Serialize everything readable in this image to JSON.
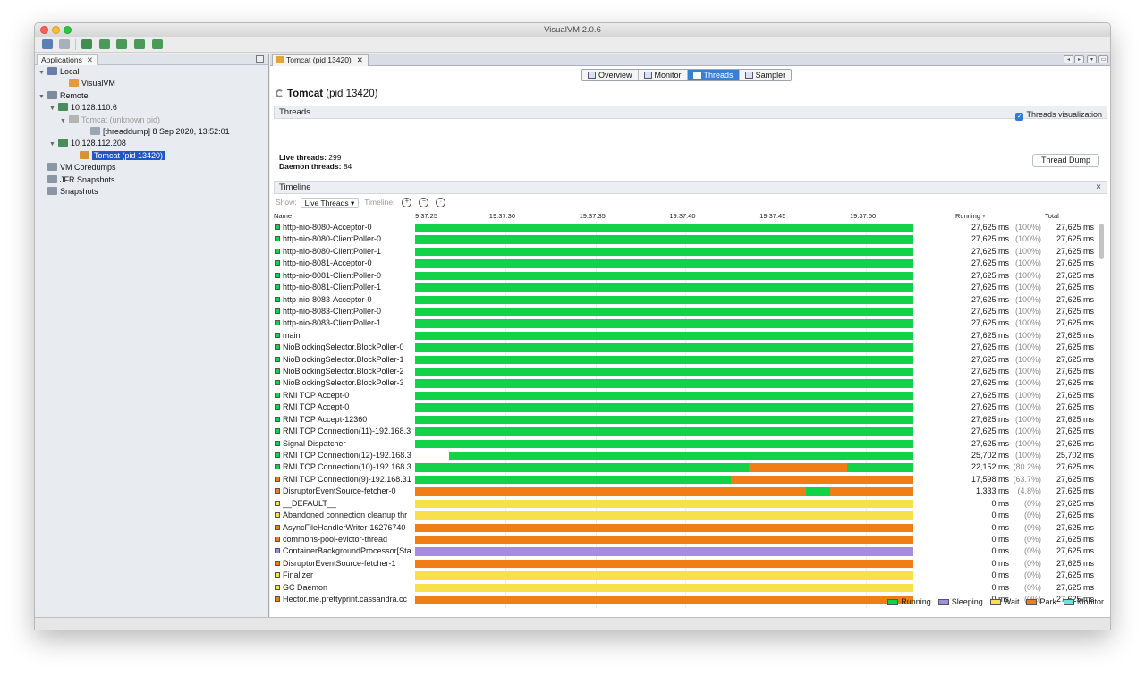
{
  "window": {
    "title": "VisualVM 2.0.6"
  },
  "left": {
    "tab_label": "Applications",
    "tree": [
      {
        "label": "Local",
        "indent": 0,
        "arrow": "▼",
        "icon": "computer-icon",
        "color": "#6b7fa6",
        "dim": false,
        "selected": false
      },
      {
        "label": "VisualVM",
        "indent": 2,
        "arrow": "",
        "icon": "java-icon",
        "color": "#e69a3c",
        "dim": false,
        "selected": false
      },
      {
        "label": "Remote",
        "indent": 0,
        "arrow": "▼",
        "icon": "network-icon",
        "color": "#7d8a9b",
        "dim": false,
        "selected": false
      },
      {
        "label": "10.128.110.6",
        "indent": 1,
        "arrow": "▼",
        "icon": "host-icon",
        "color": "#4a8d5a",
        "dim": false,
        "selected": false
      },
      {
        "label": "Tomcat (unknown pid)",
        "indent": 2,
        "arrow": "▼",
        "icon": "tomcat-icon",
        "color": "#b5b5b5",
        "dim": true,
        "selected": false
      },
      {
        "label": "[threaddump] 8 Sep 2020, 13:52:01",
        "indent": 4,
        "arrow": "",
        "icon": "threaddump-icon",
        "color": "#9ba5b3",
        "dim": false,
        "selected": false
      },
      {
        "label": "10.128.112.208",
        "indent": 1,
        "arrow": "▼",
        "icon": "host-icon",
        "color": "#4a8d5a",
        "dim": false,
        "selected": false
      },
      {
        "label": "Tomcat (pid 13420)",
        "indent": 3,
        "arrow": "",
        "icon": "tomcat-icon",
        "color": "#d89432",
        "dim": false,
        "selected": true
      },
      {
        "label": "VM Coredumps",
        "indent": 0,
        "arrow": "",
        "icon": "coredump-icon",
        "color": "#8c97a6",
        "dim": false,
        "selected": false
      },
      {
        "label": "JFR Snapshots",
        "indent": 0,
        "arrow": "",
        "icon": "jfr-icon",
        "color": "#8c97a6",
        "dim": false,
        "selected": false
      },
      {
        "label": "Snapshots",
        "indent": 0,
        "arrow": "",
        "icon": "snapshot-icon",
        "color": "#8c97a6",
        "dim": false,
        "selected": false
      }
    ]
  },
  "doc": {
    "tab_label": "Tomcat (pid 13420)",
    "views": [
      {
        "label": "Overview",
        "active": false
      },
      {
        "label": "Monitor",
        "active": false
      },
      {
        "label": "Threads",
        "active": true
      },
      {
        "label": "Sampler",
        "active": false
      }
    ],
    "app_name": "Tomcat",
    "app_pid": "(pid 13420)",
    "threads_header": "Threads",
    "viz_label": "Threads visualization",
    "live_label": "Live threads:",
    "live_value": "299",
    "daemon_label": "Daemon threads:",
    "daemon_value": "84",
    "dump_button": "Thread Dump",
    "timeline_header": "Timeline",
    "show_label": "Show:",
    "show_value": "Live Threads",
    "timeline_label": "Timeline:"
  },
  "table": {
    "col_name": "Name",
    "col_running": "Running",
    "col_total": "Total",
    "time_ticks": [
      "9:37:25",
      "19:37:30",
      "19:37:35",
      "19:37:40",
      "19:37:45",
      "19:37:50"
    ],
    "rows": [
      {
        "name": "http-nio-8080-Acceptor-0",
        "state": "running",
        "running": "27,625 ms",
        "pct": "(100%)",
        "total": "27,625 ms",
        "segments": [
          [
            "running",
            0,
            1
          ]
        ]
      },
      {
        "name": "http-nio-8080-ClientPoller-0",
        "state": "running",
        "running": "27,625 ms",
        "pct": "(100%)",
        "total": "27,625 ms",
        "segments": [
          [
            "running",
            0,
            1
          ]
        ]
      },
      {
        "name": "http-nio-8080-ClientPoller-1",
        "state": "running",
        "running": "27,625 ms",
        "pct": "(100%)",
        "total": "27,625 ms",
        "segments": [
          [
            "running",
            0,
            1
          ]
        ]
      },
      {
        "name": "http-nio-8081-Acceptor-0",
        "state": "running",
        "running": "27,625 ms",
        "pct": "(100%)",
        "total": "27,625 ms",
        "segments": [
          [
            "running",
            0,
            1
          ]
        ]
      },
      {
        "name": "http-nio-8081-ClientPoller-0",
        "state": "running",
        "running": "27,625 ms",
        "pct": "(100%)",
        "total": "27,625 ms",
        "segments": [
          [
            "running",
            0,
            1
          ]
        ]
      },
      {
        "name": "http-nio-8081-ClientPoller-1",
        "state": "running",
        "running": "27,625 ms",
        "pct": "(100%)",
        "total": "27,625 ms",
        "segments": [
          [
            "running",
            0,
            1
          ]
        ]
      },
      {
        "name": "http-nio-8083-Acceptor-0",
        "state": "running",
        "running": "27,625 ms",
        "pct": "(100%)",
        "total": "27,625 ms",
        "segments": [
          [
            "running",
            0,
            1
          ]
        ]
      },
      {
        "name": "http-nio-8083-ClientPoller-0",
        "state": "running",
        "running": "27,625 ms",
        "pct": "(100%)",
        "total": "27,625 ms",
        "segments": [
          [
            "running",
            0,
            1
          ]
        ]
      },
      {
        "name": "http-nio-8083-ClientPoller-1",
        "state": "running",
        "running": "27,625 ms",
        "pct": "(100%)",
        "total": "27,625 ms",
        "segments": [
          [
            "running",
            0,
            1
          ]
        ]
      },
      {
        "name": "main",
        "state": "running",
        "running": "27,625 ms",
        "pct": "(100%)",
        "total": "27,625 ms",
        "segments": [
          [
            "running",
            0,
            1
          ]
        ]
      },
      {
        "name": "NioBlockingSelector.BlockPoller-0",
        "state": "running",
        "running": "27,625 ms",
        "pct": "(100%)",
        "total": "27,625 ms",
        "segments": [
          [
            "running",
            0,
            1
          ]
        ]
      },
      {
        "name": "NioBlockingSelector.BlockPoller-1",
        "state": "running",
        "running": "27,625 ms",
        "pct": "(100%)",
        "total": "27,625 ms",
        "segments": [
          [
            "running",
            0,
            1
          ]
        ]
      },
      {
        "name": "NioBlockingSelector.BlockPoller-2",
        "state": "running",
        "running": "27,625 ms",
        "pct": "(100%)",
        "total": "27,625 ms",
        "segments": [
          [
            "running",
            0,
            1
          ]
        ]
      },
      {
        "name": "NioBlockingSelector.BlockPoller-3",
        "state": "running",
        "running": "27,625 ms",
        "pct": "(100%)",
        "total": "27,625 ms",
        "segments": [
          [
            "running",
            0,
            1
          ]
        ]
      },
      {
        "name": "RMI TCP Accept-0",
        "state": "running",
        "running": "27,625 ms",
        "pct": "(100%)",
        "total": "27,625 ms",
        "segments": [
          [
            "running",
            0,
            1
          ]
        ]
      },
      {
        "name": "RMI TCP Accept-0",
        "state": "running",
        "running": "27,625 ms",
        "pct": "(100%)",
        "total": "27,625 ms",
        "segments": [
          [
            "running",
            0,
            1
          ]
        ]
      },
      {
        "name": "RMI TCP Accept-12360",
        "state": "running",
        "running": "27,625 ms",
        "pct": "(100%)",
        "total": "27,625 ms",
        "segments": [
          [
            "running",
            0,
            1
          ]
        ]
      },
      {
        "name": "RMI TCP Connection(11)-192.168.3",
        "state": "running",
        "running": "27,625 ms",
        "pct": "(100%)",
        "total": "27,625 ms",
        "segments": [
          [
            "running",
            0,
            1
          ]
        ]
      },
      {
        "name": "Signal Dispatcher",
        "state": "running",
        "running": "27,625 ms",
        "pct": "(100%)",
        "total": "27,625 ms",
        "segments": [
          [
            "running",
            0,
            1
          ]
        ]
      },
      {
        "name": "RMI TCP Connection(12)-192.168.3",
        "state": "running",
        "running": "25,702 ms",
        "pct": "(100%)",
        "total": "25,702 ms",
        "segments": [
          [
            "running",
            0.069,
            1
          ]
        ]
      },
      {
        "name": "RMI TCP Connection(10)-192.168.3",
        "state": "running",
        "running": "22,152 ms",
        "pct": "(80.2%)",
        "total": "27,625 ms",
        "segments": [
          [
            "running",
            0,
            0.67
          ],
          [
            "park",
            0.67,
            0.868
          ],
          [
            "running",
            0.868,
            1
          ]
        ]
      },
      {
        "name": "RMI TCP Connection(9)-192.168.31",
        "state": "park",
        "running": "17,598 ms",
        "pct": "(63.7%)",
        "total": "27,625 ms",
        "segments": [
          [
            "running",
            0,
            0.634
          ],
          [
            "park",
            0.634,
            1
          ]
        ]
      },
      {
        "name": "DisruptorEventSource-fetcher-0",
        "state": "park",
        "running": "1,333 ms",
        "pct": "(4.8%)",
        "total": "27,625 ms",
        "segments": [
          [
            "park",
            0,
            0.785
          ],
          [
            "running",
            0.785,
            0.833
          ],
          [
            "park",
            0.833,
            1
          ]
        ]
      },
      {
        "name": "__DEFAULT__",
        "state": "wait",
        "running": "0 ms",
        "pct": "(0%)",
        "total": "27,625 ms",
        "segments": [
          [
            "wait",
            0,
            1
          ]
        ]
      },
      {
        "name": "Abandoned connection cleanup thr",
        "state": "wait",
        "running": "0 ms",
        "pct": "(0%)",
        "total": "27,625 ms",
        "segments": [
          [
            "wait",
            0,
            1
          ]
        ]
      },
      {
        "name": "AsyncFileHandlerWriter-16276740",
        "state": "park",
        "running": "0 ms",
        "pct": "(0%)",
        "total": "27,625 ms",
        "segments": [
          [
            "park",
            0,
            1
          ]
        ]
      },
      {
        "name": "commons-pool-evictor-thread",
        "state": "park",
        "running": "0 ms",
        "pct": "(0%)",
        "total": "27,625 ms",
        "segments": [
          [
            "park",
            0,
            1
          ]
        ]
      },
      {
        "name": "ContainerBackgroundProcessor[Sta",
        "state": "sleeping",
        "running": "0 ms",
        "pct": "(0%)",
        "total": "27,625 ms",
        "segments": [
          [
            "sleeping",
            0,
            1
          ]
        ]
      },
      {
        "name": "DisruptorEventSource-fetcher-1",
        "state": "park",
        "running": "0 ms",
        "pct": "(0%)",
        "total": "27,625 ms",
        "segments": [
          [
            "park",
            0,
            1
          ]
        ]
      },
      {
        "name": "Finalizer",
        "state": "wait",
        "running": "0 ms",
        "pct": "(0%)",
        "total": "27,625 ms",
        "segments": [
          [
            "wait",
            0,
            1
          ]
        ]
      },
      {
        "name": "GC Daemon",
        "state": "wait",
        "running": "0 ms",
        "pct": "(0%)",
        "total": "27,625 ms",
        "segments": [
          [
            "wait",
            0,
            1
          ]
        ]
      },
      {
        "name": "Hector.me.prettyprint.cassandra.cc",
        "state": "park",
        "running": "0 ms",
        "pct": "(0%)",
        "total": "27,625 ms",
        "segments": [
          [
            "park",
            0,
            1
          ]
        ]
      }
    ]
  },
  "legend": [
    {
      "key": "running",
      "label": "Running"
    },
    {
      "key": "sleeping",
      "label": "Sleeping"
    },
    {
      "key": "wait",
      "label": "Wait"
    },
    {
      "key": "park",
      "label": "Park"
    },
    {
      "key": "monitor",
      "label": "Monitor"
    }
  ],
  "state_colors": {
    "running": "#12d24a",
    "sleeping": "#a48de0",
    "wait": "#f8e04a",
    "park": "#f07e14",
    "monitor": "#6fe0e0"
  }
}
